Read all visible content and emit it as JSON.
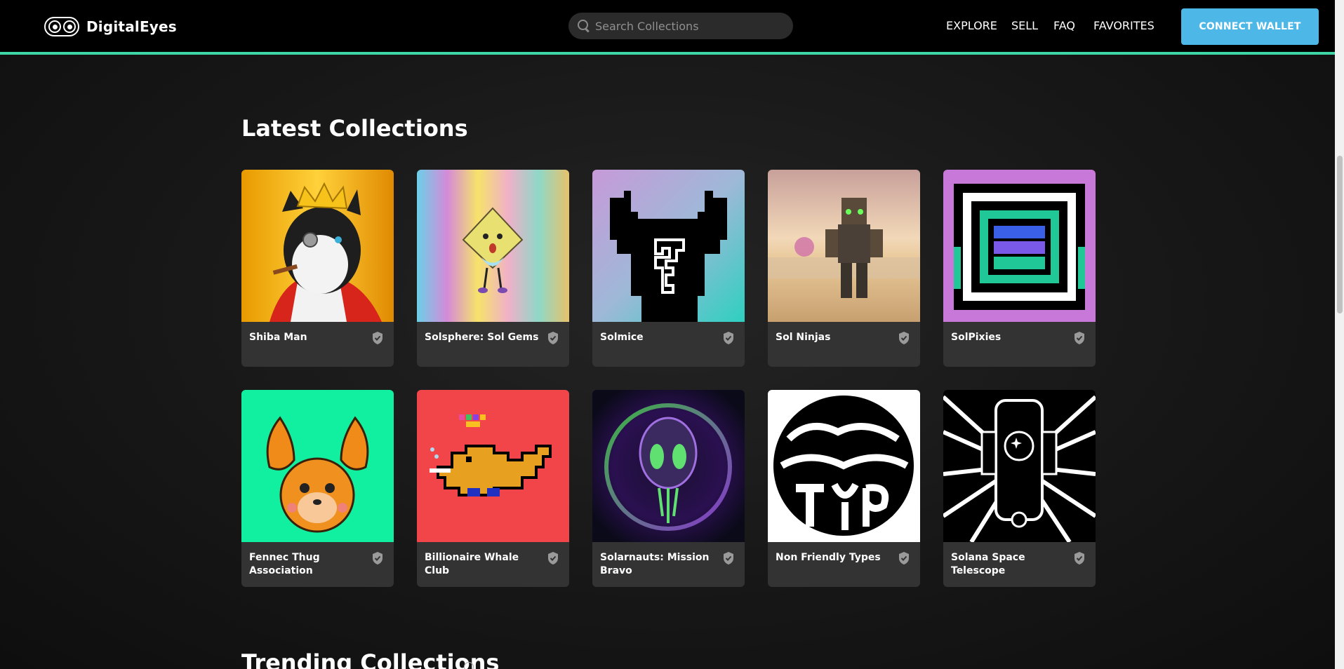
{
  "header": {
    "logo_text": "DigitalEyes",
    "search_placeholder": "Search Collections",
    "nav": [
      "EXPLORE",
      "SELL",
      "FAQ",
      "FAVORITES"
    ],
    "connect_label": "CONNECT WALLET",
    "accent_color": "#3ed6a4",
    "button_color": "#4db8e8"
  },
  "latest": {
    "title": "Latest Collections",
    "collections": [
      {
        "name": "Shiba Man",
        "icon": "verified-shield-icon"
      },
      {
        "name": "Solsphere: Sol Gems",
        "icon": "verified-shield-icon"
      },
      {
        "name": "Solmice",
        "icon": "verified-shield-icon"
      },
      {
        "name": "Sol Ninjas",
        "icon": "verified-shield-icon"
      },
      {
        "name": "SolPixies",
        "icon": "verified-shield-icon"
      },
      {
        "name": "Fennec Thug Association",
        "icon": "verified-shield-icon"
      },
      {
        "name": "Billionaire Whale Club",
        "icon": "verified-shield-icon"
      },
      {
        "name": "Solarnauts: Mission Bravo",
        "icon": "verified-shield-icon"
      },
      {
        "name": "Non Friendly Types",
        "icon": "verified-shield-icon"
      },
      {
        "name": "Solana Space Telescope",
        "icon": "verified-shield-icon"
      }
    ]
  },
  "trending": {
    "title": "Trending Collections"
  }
}
